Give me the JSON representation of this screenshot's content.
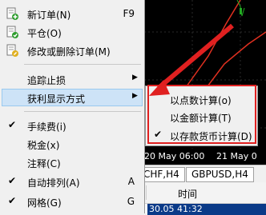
{
  "menu": {
    "items": [
      {
        "label": "新订单(N)",
        "shortcut": "F9",
        "icon": "new-order-icon"
      },
      {
        "label": "平仓(O)",
        "shortcut": "",
        "icon": "close-position-icon"
      },
      {
        "label": "修改或删除订单(M)",
        "shortcut": "",
        "icon": "modify-order-icon"
      },
      {
        "label": "追踪止损",
        "shortcut": "",
        "submenu": true
      },
      {
        "label": "获利显示方式",
        "shortcut": "",
        "submenu": true,
        "highlighted": true
      },
      {
        "label": "手续费(i)",
        "shortcut": "",
        "checked": true
      },
      {
        "label": "税金(x)",
        "shortcut": ""
      },
      {
        "label": "注释(C)",
        "shortcut": ""
      },
      {
        "label": "自动排列(A)",
        "shortcut": "A",
        "checked": true
      },
      {
        "label": "网格(G)",
        "shortcut": "G",
        "checked": true
      }
    ]
  },
  "submenu": {
    "items": [
      {
        "label": "以点数计算(o)",
        "checked": false
      },
      {
        "label": "以金额计算(T)",
        "checked": false
      },
      {
        "label": "以存款货币计算(D)",
        "checked": true
      }
    ]
  },
  "background": {
    "dates": [
      "20 May 06:00",
      "21 May 0"
    ],
    "tabs": [
      "CHF,H4",
      "GBPUSD,H4"
    ],
    "column_header": "时间",
    "row_time": "30.05 41:32"
  },
  "colors": {
    "highlight": "#cde3f7",
    "annotation": "#e02020",
    "chart_bg": "#000000",
    "chart_line": "#e03020"
  }
}
